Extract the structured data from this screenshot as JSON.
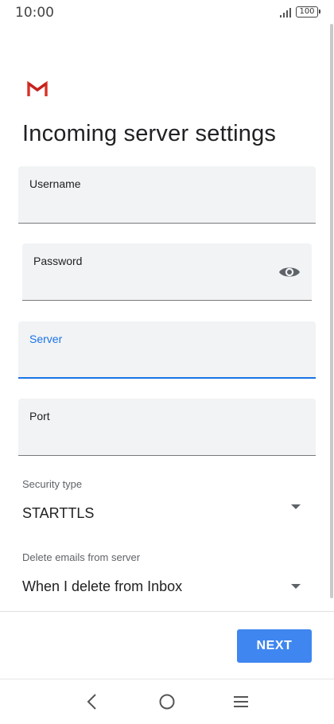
{
  "status_bar": {
    "time": "10:00",
    "battery": "100"
  },
  "app": {
    "icon": "gmail-icon",
    "accent": "#1a73e8",
    "brand_red": "#d93025"
  },
  "page": {
    "title": "Incoming server settings"
  },
  "fields": {
    "username": {
      "label": "Username",
      "value": ""
    },
    "password": {
      "label": "Password",
      "value": "",
      "icon": "eye-icon"
    },
    "server": {
      "label": "Server",
      "value": ""
    },
    "port": {
      "label": "Port",
      "value": ""
    }
  },
  "security": {
    "label": "Security type",
    "value": "STARTTLS"
  },
  "delete_emails": {
    "label": "Delete emails from server",
    "value": "When I delete from Inbox"
  },
  "footer": {
    "next_label": "NEXT",
    "button_color": "#3f86f0"
  },
  "nav": {
    "icons": [
      "back-icon",
      "home-icon",
      "menu-icon"
    ]
  }
}
